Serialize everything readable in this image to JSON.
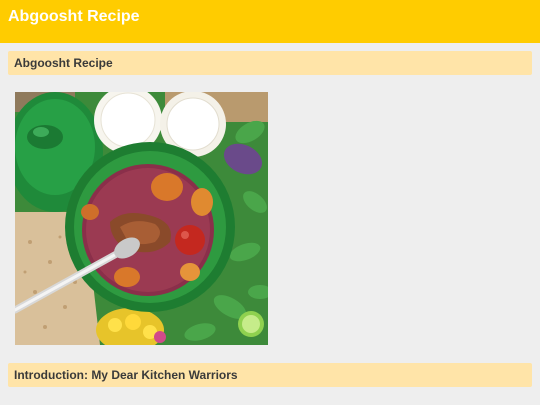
{
  "app": {
    "title": "Abgoosht Recipe"
  },
  "sections": {
    "title_header": "Abgoosht Recipe",
    "intro_header": "Introduction: My Dear Kitchen Warriors"
  },
  "image": {
    "alt": "Abgoosht Recipe"
  },
  "colors": {
    "topbar": "#ffcc00",
    "section_header": "#ffe4a8",
    "page_background": "#eeeeee"
  }
}
